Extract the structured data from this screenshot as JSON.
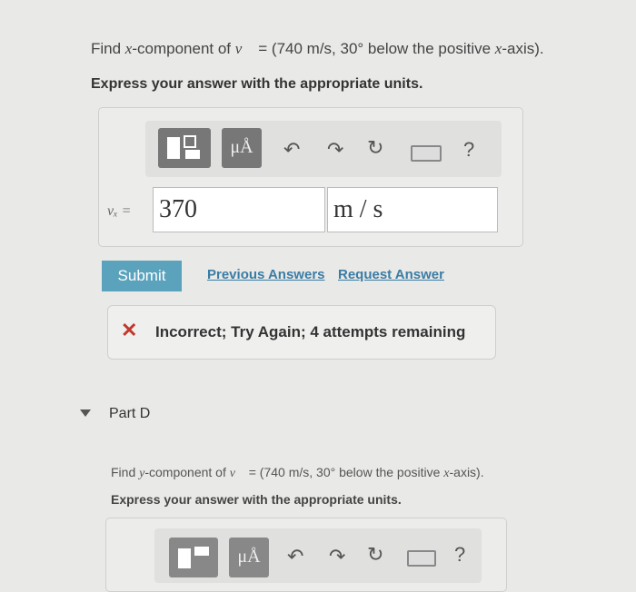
{
  "question_c": {
    "prefix": "Find ",
    "var": "x",
    "middle": "-component of ",
    "vector": "v⃗",
    "rest": " = (740 m/s, 30° below the positive ",
    "var2": "x",
    "suffix": "-axis)."
  },
  "hint_c": "Express your answer with the appropriate units.",
  "toolbar": {
    "units_button": "μÅ",
    "undo_icon": "undo",
    "redo_icon": "redo",
    "reset_icon": "reset",
    "keyboard_icon": "keyboard",
    "help": "?"
  },
  "answer": {
    "label": "vₓ =",
    "value": "370",
    "unit": "m / s"
  },
  "submit_label": "Submit",
  "links": {
    "previous": "Previous Answers",
    "request": "Request Answer"
  },
  "feedback": {
    "icon": "✕",
    "message": "Incorrect; Try Again; 4 attempts remaining"
  },
  "part_d": {
    "title": "Part D",
    "prefix": "Find ",
    "var": "y",
    "middle": "-component of ",
    "vector": "v⃗",
    "rest": " = (740 m/s, 30° below the positive ",
    "var2": "x",
    "suffix": "-axis).",
    "hint": "Express your answer with the appropriate units."
  },
  "colors": {
    "background": "#e9e9e7",
    "submit": "#5ba3bd",
    "link": "#3a7ca5",
    "error": "#c0392b"
  }
}
